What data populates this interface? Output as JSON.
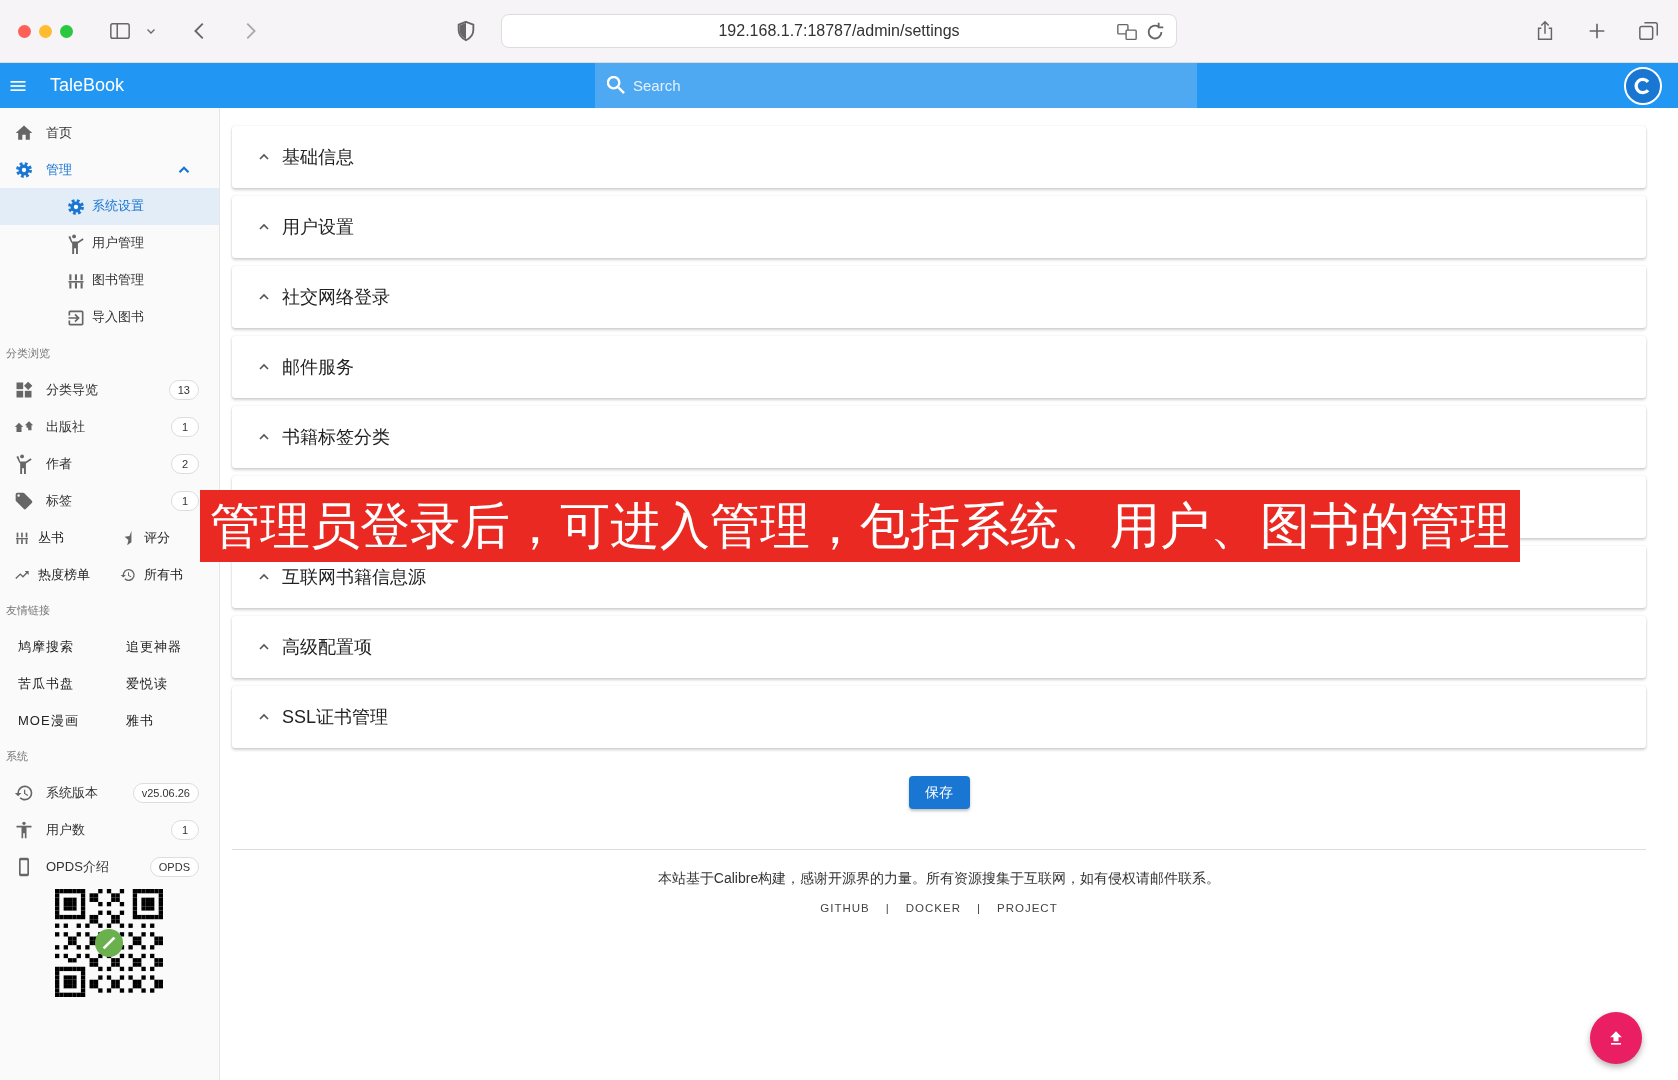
{
  "browser": {
    "url": "192.168.1.7:18787/admin/settings"
  },
  "app_bar": {
    "title": "TaleBook",
    "search": {
      "placeholder": "Search"
    }
  },
  "sidebar": {
    "nav": [
      {
        "label": "首页"
      },
      {
        "label": "管理",
        "expanded": true,
        "children": [
          {
            "label": "系统设置",
            "selected": true
          },
          {
            "label": "用户管理",
            "selected": false
          },
          {
            "label": "图书管理",
            "selected": false
          },
          {
            "label": "导入图书",
            "selected": false
          }
        ]
      }
    ],
    "sections": [
      {
        "heading": "分类浏览",
        "items": [
          {
            "kind": "badge",
            "label": "分类导览",
            "badge": "13"
          },
          {
            "kind": "badge",
            "label": "出版社",
            "badge": "1"
          },
          {
            "kind": "badge",
            "label": "作者",
            "badge": "2"
          },
          {
            "kind": "badge",
            "label": "标签",
            "badge": "1"
          },
          {
            "kind": "pair",
            "left": "丛书",
            "right": "评分"
          },
          {
            "kind": "pair",
            "left": "热度榜单",
            "right": "所有书"
          }
        ]
      },
      {
        "heading": "友情链接",
        "items": [
          {
            "kind": "links",
            "left": "鸠摩搜索",
            "right": "追更神器"
          },
          {
            "kind": "links",
            "left": "苦瓜书盘",
            "right": "爱悦读"
          },
          {
            "kind": "links",
            "left": "MOE漫画",
            "right": "雅书"
          }
        ]
      },
      {
        "heading": "系统",
        "items": [
          {
            "kind": "badge",
            "label": "系统版本",
            "badge": "v25.06.26"
          },
          {
            "kind": "badge",
            "label": "用户数",
            "badge": "1"
          },
          {
            "kind": "badge",
            "label": "OPDS介绍",
            "badge": "OPDS"
          },
          {
            "kind": "qr"
          }
        ]
      }
    ]
  },
  "panels": [
    {
      "kind": "titled",
      "title": "基础信息"
    },
    {
      "kind": "titled",
      "title": "用户设置"
    },
    {
      "kind": "titled",
      "title": "社交网络登录"
    },
    {
      "kind": "titled",
      "title": "邮件服务"
    },
    {
      "kind": "titled",
      "title": "书籍标签分类"
    },
    {
      "kind": "covered"
    },
    {
      "kind": "titled",
      "title": "互联网书籍信息源"
    },
    {
      "kind": "titled",
      "title": "高级配置项"
    },
    {
      "kind": "titled",
      "title": "SSL证书管理"
    }
  ],
  "save_button": "保存",
  "footer": {
    "text": "本站基于Calibre构建，感谢开源界的力量。所有资源搜集于互联网，如有侵权请邮件联系。",
    "links": [
      "GITHUB",
      "DOCKER",
      "PROJECT"
    ],
    "separators": [
      "|",
      "|"
    ]
  },
  "caption_overlay": {
    "text": "管理员登录后，可进入管理，包括系统、用户、图书的管理"
  }
}
